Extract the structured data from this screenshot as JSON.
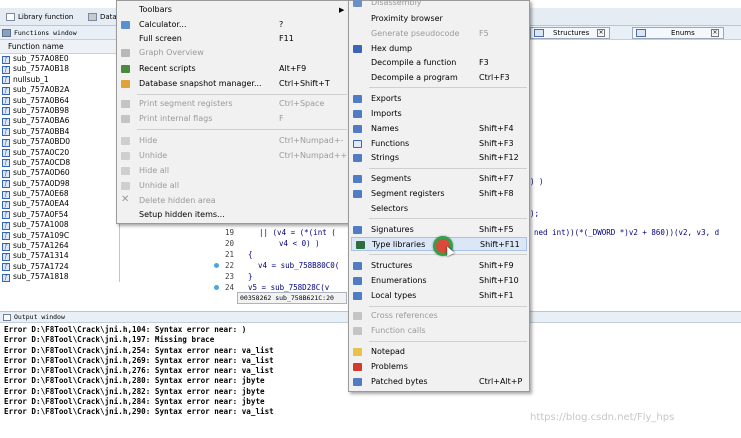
{
  "tabs": {
    "library_function": "Library function",
    "data": "Data"
  },
  "functions_window": {
    "title": "Functions window",
    "column": "Function name",
    "items": [
      "sub_757A08E0",
      "sub_757A0B18",
      "nullsub_1",
      "sub_757A0B2A",
      "sub_757A0B64",
      "sub_757A0B98",
      "sub_757A0BA6",
      "sub_757A0BB4",
      "sub_757A0BD0",
      "sub_757A0C20",
      "sub_757A0CD8",
      "sub_757A0D60",
      "sub_757A0D98",
      "sub_757A0E68",
      "sub_757A0EA4",
      "sub_757A0F54",
      "sub_757A1008",
      "sub_757A109C",
      "sub_757A1264",
      "sub_757A1314",
      "sub_757A1724",
      "sub_757A1818"
    ]
  },
  "right_tabs": {
    "structures": "Structures",
    "enums": "Enums"
  },
  "code": {
    "line_tail_1": ") )",
    "line_tail_2": ");",
    "line_19_num": "19",
    "line_19": "|| (v4 = (*(int (",
    "line_19_right": "ned int))(*(_DWORD *)v2 + 860))(v2, v3, d",
    "line_20_num": "20",
    "line_20": "v4 < 0) )",
    "line_21_num": "21",
    "line_21": "{",
    "line_22_num": "22",
    "line_22": "v4 = sub_758B80C0(",
    "line_23_num": "23",
    "line_23": "}",
    "line_24_num": "24",
    "line_24": "v5 = sub_758D28C(v",
    "status": "00358262 sub_758B621C:20"
  },
  "output_window": {
    "title": "Output window",
    "lines": [
      "Error D:\\F8Tool\\Crack\\jni.h,104: Syntax error near: )",
      "Error D:\\F8Tool\\Crack\\jni.h,197: Missing brace",
      "Error D:\\F8Tool\\Crack\\jni.h,254: Syntax error near: va_list",
      "Error D:\\F8Tool\\Crack\\jni.h,269: Syntax error near: va_list",
      "Error D:\\F8Tool\\Crack\\jni.h,276: Syntax error near: va_list",
      "Error D:\\F8Tool\\Crack\\jni.h,280: Syntax error near: jbyte",
      "Error D:\\F8Tool\\Crack\\jni.h,282: Syntax error near: jbyte",
      "Error D:\\F8Tool\\Crack\\jni.h,284: Syntax error near: jbyte",
      "Error D:\\F8Tool\\Crack\\jni.h,290: Syntax error near: va_list"
    ]
  },
  "menu_left": {
    "toolbars": "Toolbars",
    "calculator": "Calculator...",
    "calculator_sc": "?",
    "full_screen": "Full screen",
    "full_screen_sc": "F11",
    "graph_overview": "Graph Overview",
    "recent_scripts": "Recent scripts",
    "recent_scripts_sc": "Alt+F9",
    "db_snapshot": "Database snapshot manager...",
    "db_snapshot_sc": "Ctrl+Shift+T",
    "print_segment_registers": "Print segment registers",
    "print_segment_registers_sc": "Ctrl+Space",
    "print_internal_flags": "Print internal flags",
    "print_internal_flags_sc": "F",
    "hide": "Hide",
    "hide_sc": "Ctrl+Numpad+-",
    "unhide": "Unhide",
    "unhide_sc": "Ctrl+Numpad++",
    "hide_all": "Hide all",
    "unhide_all": "Unhide all",
    "delete_hidden_area": "Delete hidden area",
    "setup_hidden_items": "Setup hidden items..."
  },
  "menu_right": {
    "disassembly": "Disassembly",
    "proximity_browser": "Proximity browser",
    "generate_pseudocode": "Generate pseudocode",
    "generate_pseudocode_sc": "F5",
    "hex_dump": "Hex dump",
    "decompile_function": "Decompile a function",
    "decompile_function_sc": "F3",
    "decompile_program": "Decompile a program",
    "decompile_program_sc": "Ctrl+F3",
    "exports": "Exports",
    "imports": "Imports",
    "names": "Names",
    "names_sc": "Shift+F4",
    "functions": "Functions",
    "functions_sc": "Shift+F3",
    "strings": "Strings",
    "strings_sc": "Shift+F12",
    "segments": "Segments",
    "segments_sc": "Shift+F7",
    "segment_registers": "Segment registers",
    "segment_registers_sc": "Shift+F8",
    "selectors": "Selectors",
    "signatures": "Signatures",
    "signatures_sc": "Shift+F5",
    "type_libraries": "Type libraries",
    "type_libraries_sc": "Shift+F11",
    "structures": "Structures",
    "structures_sc": "Shift+F9",
    "enumerations": "Enumerations",
    "enumerations_sc": "Shift+F10",
    "local_types": "Local types",
    "local_types_sc": "Shift+F1",
    "cross_references": "Cross references",
    "function_calls": "Function calls",
    "notepad": "Notepad",
    "problems": "Problems",
    "patched_bytes": "Patched bytes",
    "patched_bytes_sc": "Ctrl+Alt+P"
  },
  "watermark": "https://blog.csdn.net/Fly_hps",
  "colors": {
    "menu_bg": "#f1f1f1",
    "highlight": "#dbe7f6",
    "code_text": "#000080",
    "breakpoint_dot": "#47a7e3"
  }
}
